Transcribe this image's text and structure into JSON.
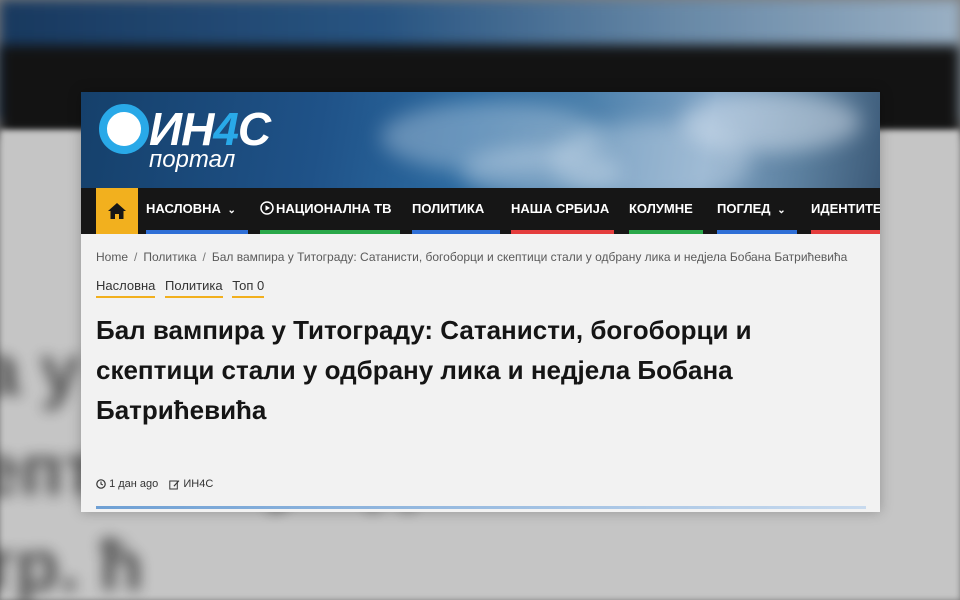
{
  "site": {
    "logo_main": "ИН",
    "logo_four": "4",
    "logo_after": "С",
    "logo_sub": "портал",
    "brand_color": "#29a9e8",
    "accent_color": "#f2b01e"
  },
  "nav": {
    "home_icon": "home-icon",
    "items": [
      {
        "label": "НАСЛОВНА",
        "has_dropdown": true,
        "underline": "#2f6fd6"
      },
      {
        "label": "НАЦИОНАЛНА ТВ",
        "icon": "play-circle-icon",
        "underline": "#2aa84a"
      },
      {
        "label": "ПОЛИТИКА",
        "underline": "#2f6fd6"
      },
      {
        "label": "НАША СРБИЈА",
        "underline": "#e43d3d"
      },
      {
        "label": "КОЛУМНЕ",
        "underline": "#2aa84a"
      },
      {
        "label": "ПОГЛЕД",
        "has_dropdown": true,
        "underline": "#2f6fd6"
      },
      {
        "label": "ИДЕНТИТЕ",
        "underline": "#e43d3d"
      }
    ]
  },
  "breadcrumb": {
    "items": [
      "Home",
      "Политика",
      "Бал вампира у Титограду: Сатанисти, богоборци и скептици стали у одбрану лика и недјела Бобана Батрићевића"
    ],
    "separator": "/"
  },
  "categories": [
    "Насловна",
    "Политика",
    "Топ 0"
  ],
  "article": {
    "title": "Бал вампира у Титограду: Сатанисти, богоборци и скептици стали у одбрану лика и недјела Бобана Батрићевића",
    "time": "1 дан ago",
    "author": "ИН4С"
  },
  "background": {
    "blur_line_1": "а у Титогр бор",
    "blur_line_2": "епт ала у од",
    "blur_line_3": "тр. ћ"
  }
}
